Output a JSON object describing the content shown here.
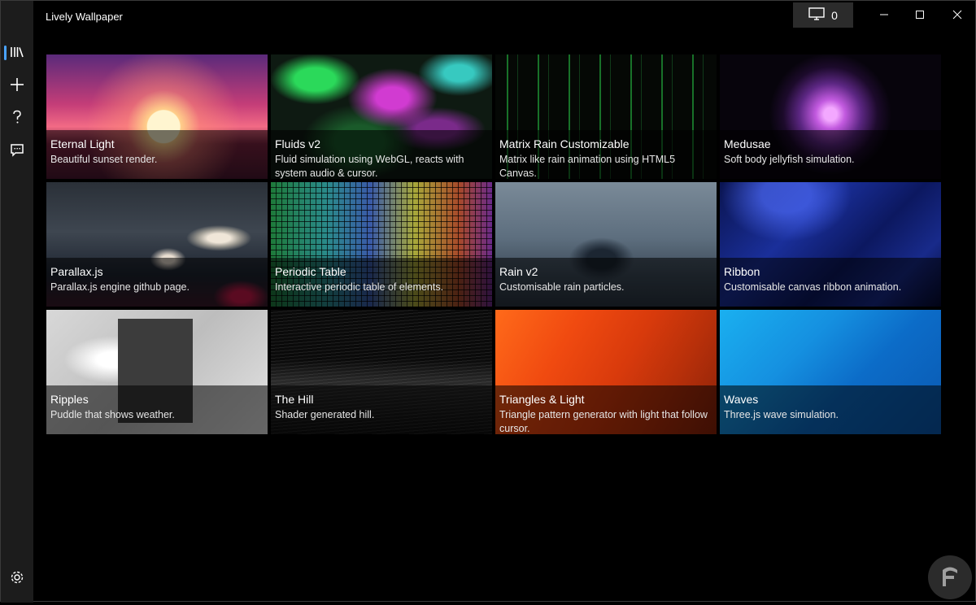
{
  "app": {
    "title": "Lively Wallpaper"
  },
  "titlebar": {
    "monitor_count": "0"
  },
  "sidebar": {
    "items": [
      {
        "icon": "library-icon",
        "name": "library"
      },
      {
        "icon": "add-icon",
        "name": "add"
      },
      {
        "icon": "help-icon",
        "name": "help"
      },
      {
        "icon": "feedback-icon",
        "name": "feedback"
      },
      {
        "icon": "settings-icon",
        "name": "settings"
      }
    ]
  },
  "library": {
    "wallpapers": [
      {
        "title": "Eternal Light",
        "description": "Beautiful sunset render."
      },
      {
        "title": "Fluids v2",
        "description": "Fluid simulation using WebGL, reacts with system audio & cursor."
      },
      {
        "title": "Matrix Rain Customizable",
        "description": "Matrix like rain animation using HTML5 Canvas."
      },
      {
        "title": "Medusae",
        "description": "Soft body jellyfish simulation."
      },
      {
        "title": "Parallax.js",
        "description": "Parallax.js engine github page."
      },
      {
        "title": "Periodic Table",
        "description": "Interactive periodic table of elements."
      },
      {
        "title": "Rain v2",
        "description": "Customisable rain particles."
      },
      {
        "title": "Ribbon",
        "description": "Customisable canvas ribbon animation."
      },
      {
        "title": "Ripples",
        "description": "Puddle that shows weather."
      },
      {
        "title": "The Hill",
        "description": "Shader generated hill."
      },
      {
        "title": "Triangles & Light",
        "description": "Triangle pattern generator with light that follow cursor."
      },
      {
        "title": "Waves",
        "description": "Three.js wave simulation."
      }
    ]
  },
  "colors": {
    "accent": "#4aa3ff",
    "sidebar_bg": "#1c1c1c",
    "window_bg": "#000000"
  }
}
